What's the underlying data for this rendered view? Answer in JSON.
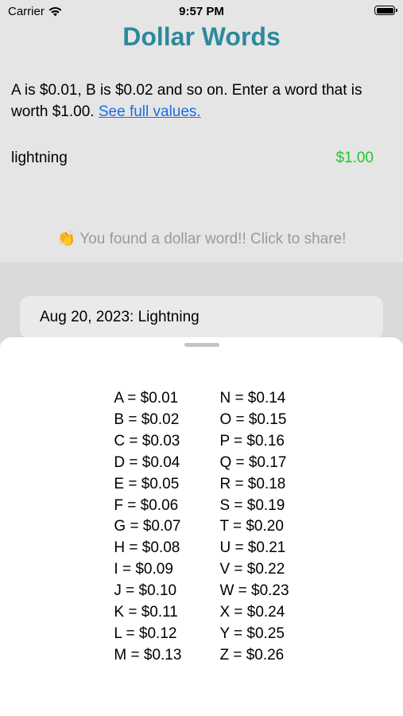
{
  "status_bar": {
    "carrier": "Carrier",
    "time": "9:57 PM",
    "wifi_icon": "wifi-icon",
    "battery_icon": "battery-icon"
  },
  "app": {
    "title": "Dollar Words",
    "title_color": "#2a8a9c"
  },
  "instructions": {
    "text": "A is $0.01, B is $0.02 and so on. Enter a word that is worth $1.00.",
    "link_label": "See full values."
  },
  "word_input": {
    "value": "lightning",
    "worth": "$1.00",
    "worth_color": "#20c828"
  },
  "found_message": {
    "emoji": "👏",
    "text": "You found a dollar word!! Click to share!"
  },
  "history": [
    {
      "label": "Aug 20, 2023: Lightning"
    }
  ],
  "values_sheet": {
    "left_column": [
      "A = $0.01",
      "B = $0.02",
      "C = $0.03",
      "D = $0.04",
      "E = $0.05",
      "F = $0.06",
      "G = $0.07",
      "H = $0.08",
      "I = $0.09",
      "J = $0.10",
      "K = $0.11",
      "L = $0.12",
      "M = $0.13"
    ],
    "right_column": [
      "N = $0.14",
      "O = $0.15",
      "P = $0.16",
      "Q = $0.17",
      "R = $0.18",
      "S = $0.19",
      "T = $0.20",
      "U = $0.21",
      "V = $0.22",
      "W = $0.23",
      "X = $0.24",
      "Y = $0.25",
      "Z = $0.26"
    ]
  }
}
